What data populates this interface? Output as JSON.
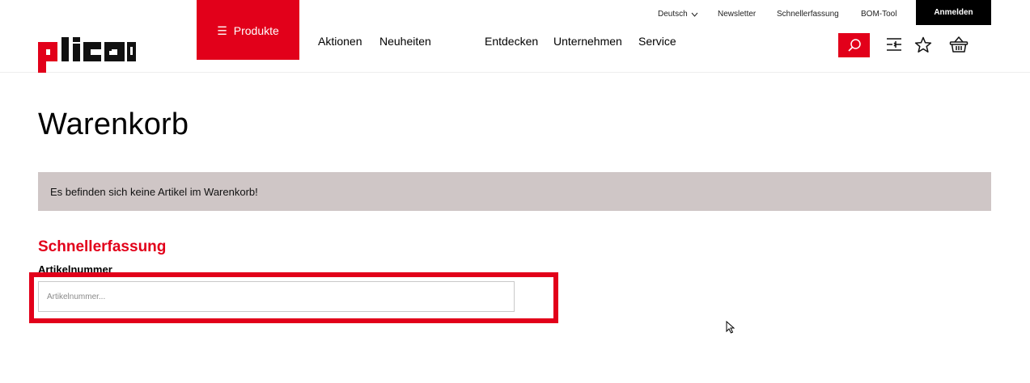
{
  "header": {
    "logo_text": "plica",
    "produkte_label": "Produkte",
    "nav": [
      "Aktionen",
      "Neuheiten",
      "Entdecken",
      "Unternehmen",
      "Service"
    ],
    "top_links": {
      "language": "Deutsch",
      "newsletter": "Newsletter",
      "quick_entry": "Schnellerfassung",
      "bom_tool": "BOM-Tool"
    },
    "login_label": "Anmelden",
    "icons": [
      "search-icon",
      "compare-icon",
      "star-icon",
      "basket-icon",
      "chevron-down-icon",
      "menu-icon"
    ]
  },
  "main": {
    "title": "Warenkorb",
    "empty_notice": "Es befinden sich keine Artikel im Warenkorb!",
    "quick_entry": {
      "title": "Schnellerfassung",
      "field_label": "Artikelnummer",
      "input_placeholder": "Artikelnummer...",
      "input_value": ""
    }
  },
  "colors": {
    "brand_red": "#e2001a",
    "notice_bg": "#cfc6c6",
    "login_bg": "#000000"
  }
}
